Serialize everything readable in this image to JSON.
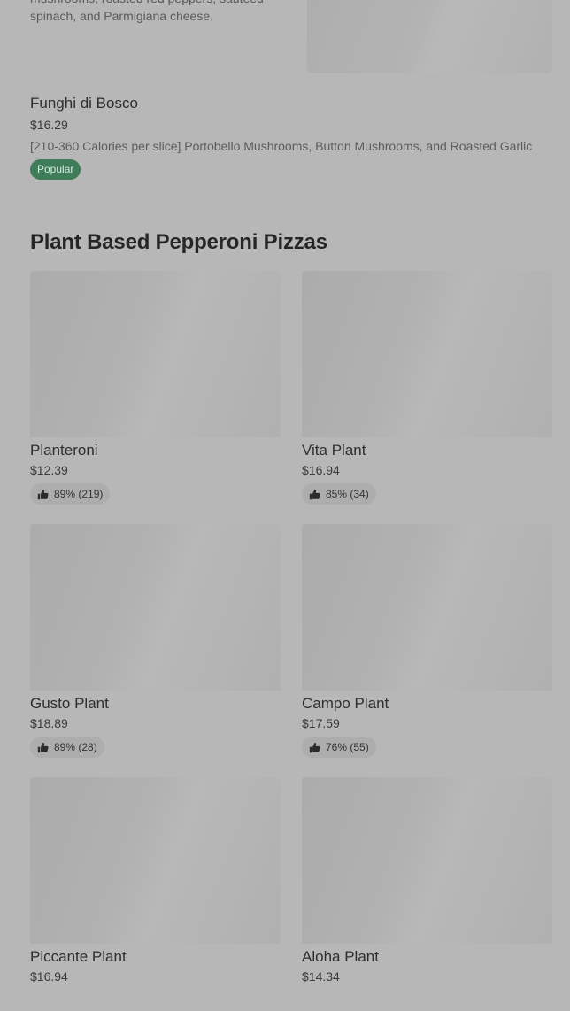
{
  "top_item": {
    "description": "mushrooms, roasted red peppers, sauteed spinach, and Parmigiana cheese."
  },
  "funghi": {
    "name": "Funghi di Bosco",
    "price": "$16.29",
    "description": "[210-360 Calories per slice] Portobello Mushrooms, Button Mushrooms, and Roasted Garlic",
    "badge": "Popular"
  },
  "section": {
    "title": "Plant Based Pepperoni Pizzas"
  },
  "items": [
    {
      "name": "Planteroni",
      "price": "$12.39",
      "rating": "89% (219)"
    },
    {
      "name": "Vita Plant",
      "price": "$16.94",
      "rating": "85% (34)"
    },
    {
      "name": "Gusto Plant",
      "price": "$18.89",
      "rating": "89% (28)"
    },
    {
      "name": "Campo Plant",
      "price": "$17.59",
      "rating": "76% (55)"
    },
    {
      "name": "Piccante Plant",
      "price": "$16.94",
      "rating": ""
    },
    {
      "name": "Aloha Plant",
      "price": "$14.34",
      "rating": ""
    }
  ],
  "icons": {
    "rating": "thumbs-up-icon"
  },
  "colors": {
    "background": "#b7b7b7",
    "popular_badge": "#3f7c5a"
  }
}
